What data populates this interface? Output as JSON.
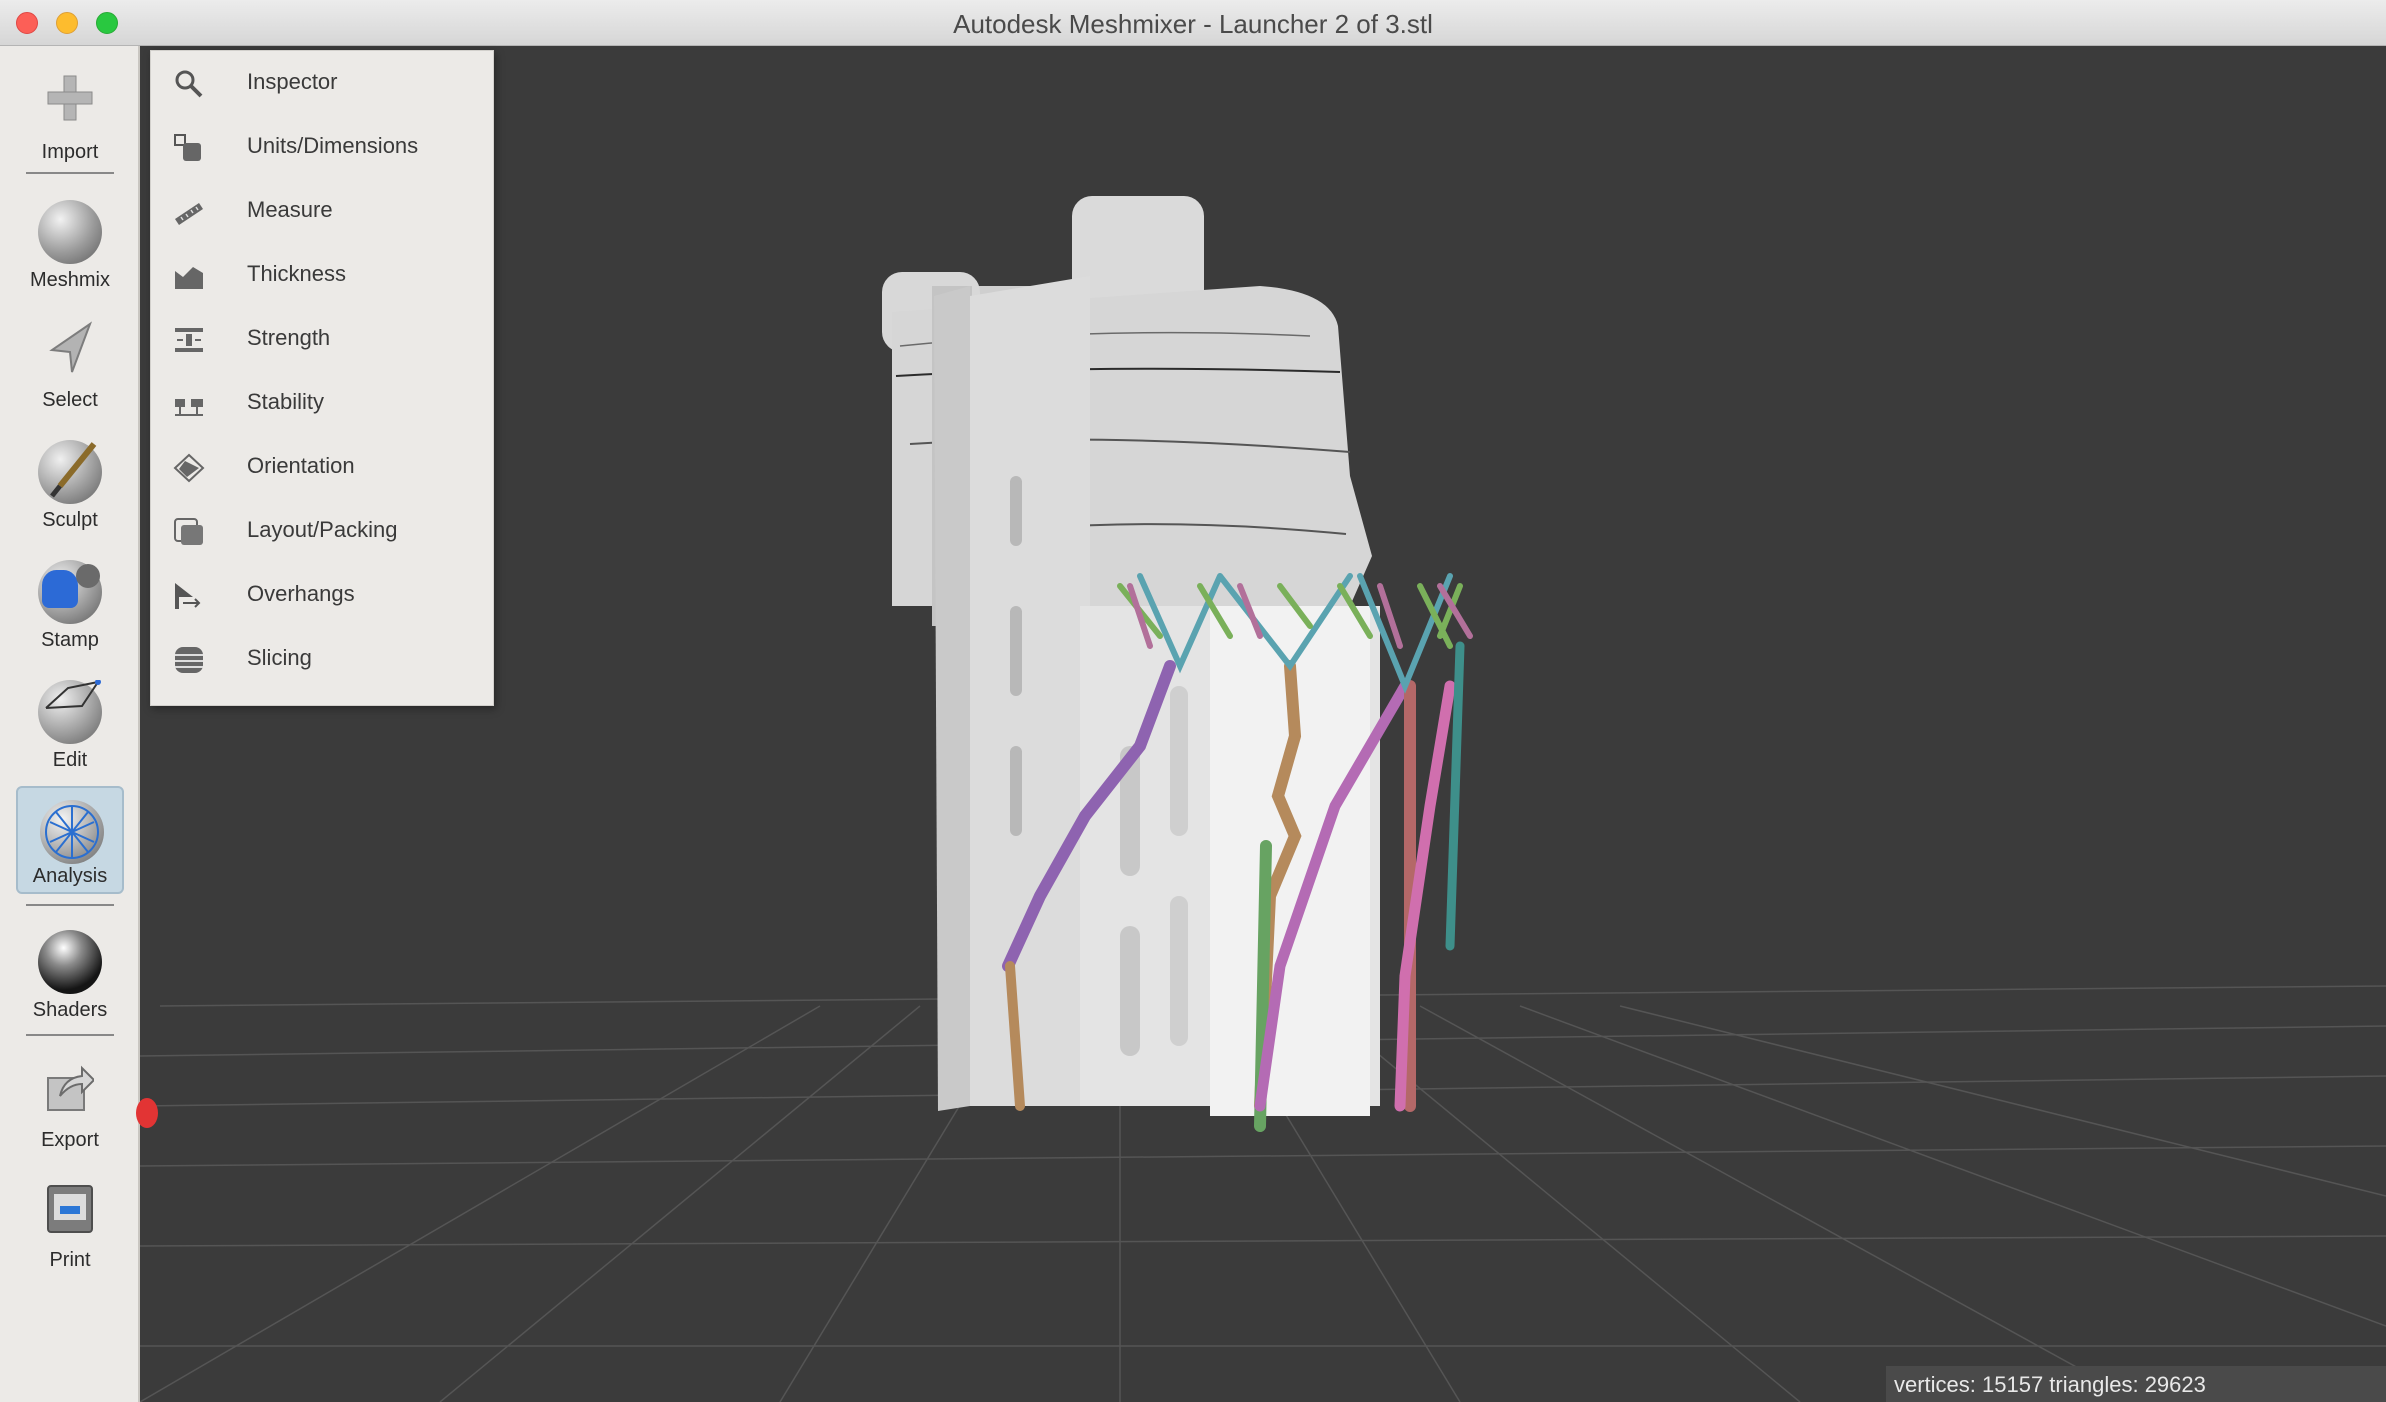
{
  "window": {
    "title": "Autodesk Meshmixer - Launcher 2 of 3.stl"
  },
  "toolbar": {
    "tools": [
      {
        "label": "Import",
        "icon": "plus-icon"
      },
      {
        "label": "Meshmix",
        "icon": "meshmix-icon"
      },
      {
        "label": "Select",
        "icon": "select-arrow-icon"
      },
      {
        "label": "Sculpt",
        "icon": "sculpt-brush-icon"
      },
      {
        "label": "Stamp",
        "icon": "stamp-icon"
      },
      {
        "label": "Edit",
        "icon": "edit-icon"
      },
      {
        "label": "Analysis",
        "icon": "analysis-icon",
        "active": true
      },
      {
        "label": "Shaders",
        "icon": "shader-sphere-icon"
      },
      {
        "label": "Export",
        "icon": "export-icon"
      },
      {
        "label": "Print",
        "icon": "printer-icon"
      }
    ]
  },
  "analysis_menu": {
    "items": [
      {
        "label": "Inspector",
        "icon": "magnifier-icon"
      },
      {
        "label": "Units/Dimensions",
        "icon": "units-dimensions-icon"
      },
      {
        "label": "Measure",
        "icon": "ruler-icon"
      },
      {
        "label": "Thickness",
        "icon": "thickness-icon"
      },
      {
        "label": "Strength",
        "icon": "strength-icon"
      },
      {
        "label": "Stability",
        "icon": "stability-icon"
      },
      {
        "label": "Orientation",
        "icon": "orientation-icon"
      },
      {
        "label": "Layout/Packing",
        "icon": "layout-packing-icon"
      },
      {
        "label": "Overhangs",
        "icon": "overhangs-icon"
      },
      {
        "label": "Slicing",
        "icon": "slicing-icon"
      }
    ]
  },
  "status": {
    "text": "vertices: 15157 triangles: 29623"
  },
  "colors": {
    "viewport_bg": "#3b3b3b",
    "panel_bg": "#eceae7",
    "active_tool": "#c6d8e3"
  }
}
